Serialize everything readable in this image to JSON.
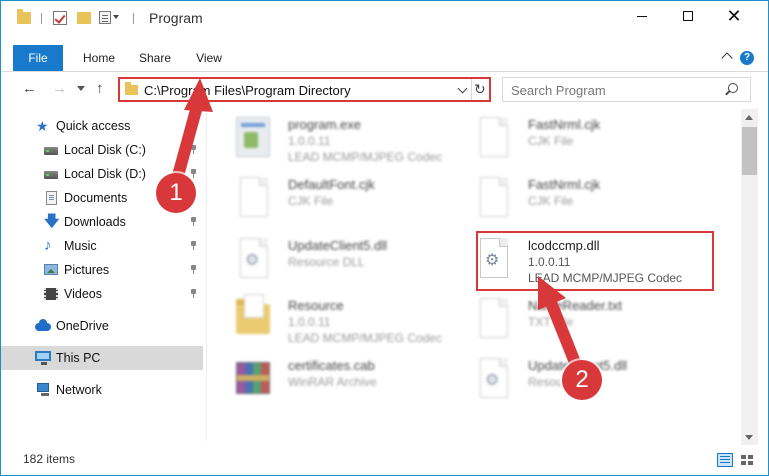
{
  "window": {
    "title": "Program",
    "minimize_icon": "minimize-icon",
    "maximize_icon": "maximize-icon",
    "close_icon": "close-icon"
  },
  "ribbon": {
    "tabs": [
      {
        "label": "File"
      },
      {
        "label": "Home"
      },
      {
        "label": "Share"
      },
      {
        "label": "View"
      }
    ]
  },
  "address": {
    "path": "C:\\Program Files\\Program Directory"
  },
  "search": {
    "placeholder": "Search Program"
  },
  "nav": {
    "items": [
      {
        "label": "Quick access",
        "icon": "star-icon"
      },
      {
        "label": "Local Disk (C:)",
        "icon": "drive-icon"
      },
      {
        "label": "Local Disk (D:)",
        "icon": "drive-icon"
      },
      {
        "label": "Documents",
        "icon": "documents-icon"
      },
      {
        "label": "Downloads",
        "icon": "download-icon"
      },
      {
        "label": "Music",
        "icon": "music-icon"
      },
      {
        "label": "Pictures",
        "icon": "pictures-icon"
      },
      {
        "label": "Videos",
        "icon": "videos-icon"
      },
      {
        "label": "OneDrive",
        "icon": "cloud-icon"
      },
      {
        "label": "This PC",
        "icon": "computer-icon"
      },
      {
        "label": "Network",
        "icon": "network-icon"
      }
    ]
  },
  "files": [
    {
      "name": "program.exe",
      "line2": "1.0.0.11",
      "line3": "LEAD MCMP/MJPEG Codec",
      "icon": "exe-icon"
    },
    {
      "name": "FastNrml.cjk",
      "line2": "CJK File",
      "line3": "",
      "icon": "file-icon"
    },
    {
      "name": "DefaultFont.cjk",
      "line2": "CJK File",
      "line3": "",
      "icon": "file-icon"
    },
    {
      "name": "FastNrml.cjk",
      "line2": "CJK File",
      "line3": "",
      "icon": "file-icon"
    },
    {
      "name": "UpdateClient5.dll",
      "line2": "Resource DLL",
      "line3": "",
      "icon": "dll-icon"
    },
    {
      "name": "lcodccmp.dll",
      "line2": "1.0.0.11",
      "line3": "LEAD MCMP/MJPEG Codec",
      "icon": "dll-icon"
    },
    {
      "name": "Resource",
      "line2": "1.0.0.11",
      "line3": "LEAD MCMP/MJPEG Codec",
      "icon": "folder-icon"
    },
    {
      "name": "NameReader.txt",
      "line2": "TXT File",
      "line3": "",
      "icon": "file-icon"
    },
    {
      "name": "certificates.cab",
      "line2": "WinRAR Archive",
      "line3": "",
      "icon": "archive-icon"
    },
    {
      "name": "UpdateClient5.dll",
      "line2": "Resource",
      "line3": "",
      "icon": "dll-icon"
    }
  ],
  "status": {
    "item_count": "182 items"
  },
  "callouts": {
    "step1": "1",
    "step2": "2",
    "color": "#d9383a"
  },
  "colors": {
    "accent": "#1979ca",
    "highlight": "#d9383a"
  }
}
